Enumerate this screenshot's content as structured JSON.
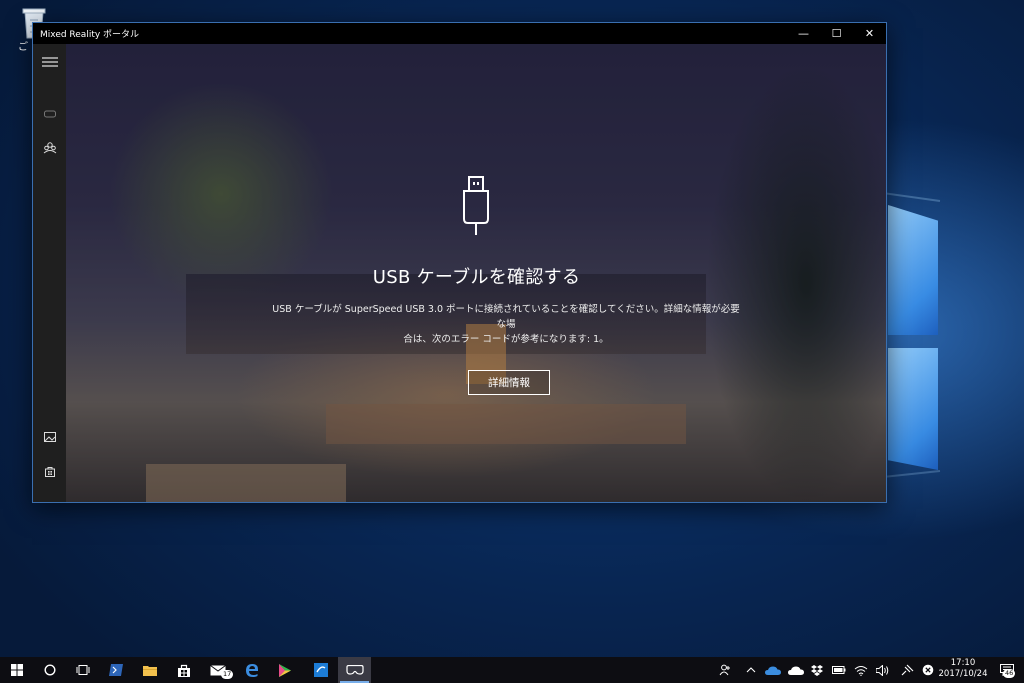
{
  "desktop": {
    "recycle_bin_label": "ご"
  },
  "window": {
    "title": "Mixed Reality ポータル",
    "minimize_glyph": "—",
    "maximize_glyph": "☐",
    "close_glyph": "✕"
  },
  "sidebar": {
    "items": [
      {
        "name": "menu-icon"
      },
      {
        "name": "headset-icon"
      },
      {
        "name": "people-icon"
      },
      {
        "name": "gallery-icon"
      },
      {
        "name": "store-icon"
      },
      {
        "name": "more-icon",
        "glyph": "…"
      }
    ]
  },
  "main": {
    "icon": "usb-icon",
    "heading": "USB ケーブルを確認する",
    "message_line1": "USB ケーブルが SuperSpeed USB 3.0 ポートに接続されていることを確認してください。詳細な情報が必要な場",
    "message_line2": "合は、次のエラー コードが参考になります: 1。",
    "detail_button": "詳細情報"
  },
  "taskbar": {
    "apps": [
      {
        "name": "start-icon"
      },
      {
        "name": "cortana-icon"
      },
      {
        "name": "task-view-icon"
      },
      {
        "name": "powershell-icon"
      },
      {
        "name": "file-explorer-icon"
      },
      {
        "name": "store-icon"
      },
      {
        "name": "mail-icon",
        "badge": "17"
      },
      {
        "name": "edge-icon"
      },
      {
        "name": "media-player-icon"
      },
      {
        "name": "app-icon"
      },
      {
        "name": "mixed-reality-portal-icon"
      }
    ],
    "tray": {
      "clock_time": "17:10",
      "clock_date": "2017/10/24",
      "notification_badge": "46"
    }
  },
  "colors": {
    "accent": "#78aeea",
    "titlebar": "#000000",
    "taskbar": "#0d0d12"
  }
}
